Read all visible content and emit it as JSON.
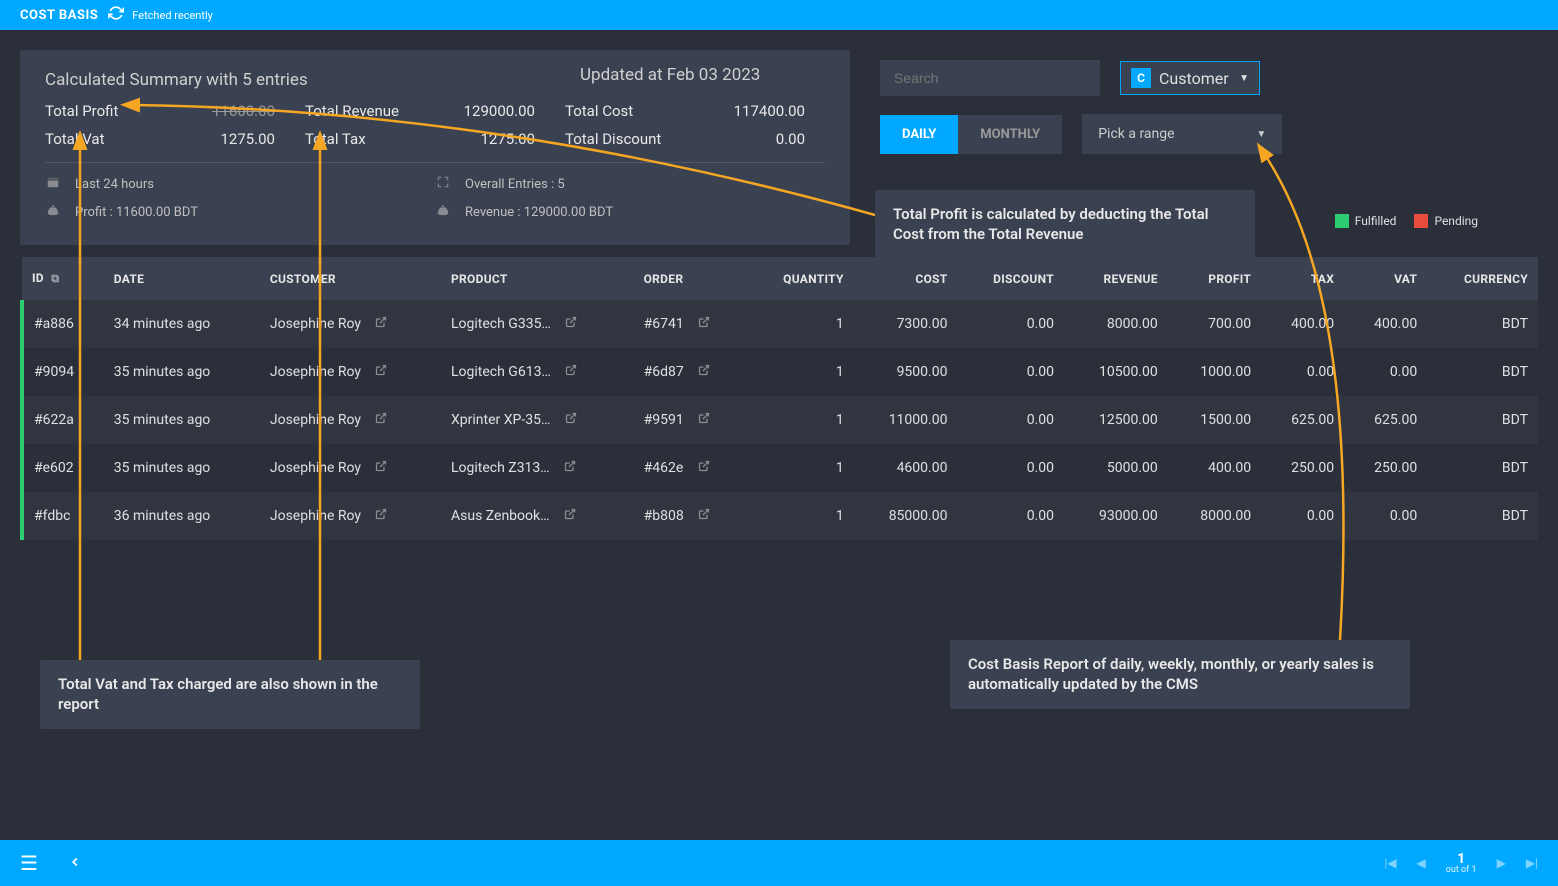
{
  "header": {
    "title": "COST BASIS",
    "fetched_label": "Fetched recently"
  },
  "summary": {
    "title": "Calculated Summary with 5 entries",
    "updated_label": "Updated at Feb 03 2023",
    "total_profit_label": "Total Profit",
    "total_profit_value": "11600.00",
    "total_revenue_label": "Total Revenue",
    "total_revenue_value": "129000.00",
    "total_cost_label": "Total Cost",
    "total_cost_value": "117400.00",
    "total_vat_label": "Total Vat",
    "total_vat_value": "1275.00",
    "total_tax_label": "Total Tax",
    "total_tax_value": "1275.00",
    "total_discount_label": "Total Discount",
    "total_discount_value": "0.00",
    "last24_label": "Last 24 hours",
    "overall_entries_label": "Overall Entries : 5",
    "profit_label": "Profit : 11600.00 BDT",
    "revenue_label": "Revenue : 129000.00 BDT"
  },
  "controls": {
    "search_placeholder": "Search",
    "filter_badge": "C",
    "filter_label": "Customer",
    "tab_daily": "DAILY",
    "tab_monthly": "MONTHLY",
    "range_label": "Pick a range",
    "legend_fulfilled": "Fulfilled",
    "legend_pending": "Pending"
  },
  "table": {
    "headers": {
      "id": "ID",
      "date": "DATE",
      "customer": "CUSTOMER",
      "product": "PRODUCT",
      "order": "ORDER",
      "quantity": "QUANTITY",
      "cost": "COST",
      "discount": "DISCOUNT",
      "revenue": "REVENUE",
      "profit": "PROFIT",
      "tax": "TAX",
      "vat": "VAT",
      "currency": "CURRENCY"
    },
    "rows": [
      {
        "id": "#a886",
        "date": "34 minutes ago",
        "customer": "Josephine Roy",
        "product": "Logitech G335…",
        "order": "#6741",
        "quantity": "1",
        "cost": "7300.00",
        "discount": "0.00",
        "revenue": "8000.00",
        "profit": "700.00",
        "tax": "400.00",
        "vat": "400.00",
        "currency": "BDT"
      },
      {
        "id": "#9094",
        "date": "35 minutes ago",
        "customer": "Josephine Roy",
        "product": "Logitech G613…",
        "order": "#6d87",
        "quantity": "1",
        "cost": "9500.00",
        "discount": "0.00",
        "revenue": "10500.00",
        "profit": "1000.00",
        "tax": "0.00",
        "vat": "0.00",
        "currency": "BDT"
      },
      {
        "id": "#622a",
        "date": "35 minutes ago",
        "customer": "Josephine Roy",
        "product": "Xprinter XP-35…",
        "order": "#9591",
        "quantity": "1",
        "cost": "11000.00",
        "discount": "0.00",
        "revenue": "12500.00",
        "profit": "1500.00",
        "tax": "625.00",
        "vat": "625.00",
        "currency": "BDT"
      },
      {
        "id": "#e602",
        "date": "35 minutes ago",
        "customer": "Josephine Roy",
        "product": "Logitech Z313…",
        "order": "#462e",
        "quantity": "1",
        "cost": "4600.00",
        "discount": "0.00",
        "revenue": "5000.00",
        "profit": "400.00",
        "tax": "250.00",
        "vat": "250.00",
        "currency": "BDT"
      },
      {
        "id": "#fdbc",
        "date": "36 minutes ago",
        "customer": "Josephine Roy",
        "product": "Asus Zenbook…",
        "order": "#b808",
        "quantity": "1",
        "cost": "85000.00",
        "discount": "0.00",
        "revenue": "93000.00",
        "profit": "8000.00",
        "tax": "0.00",
        "vat": "0.00",
        "currency": "BDT"
      }
    ]
  },
  "annotations": {
    "profit_calc": "Total Profit is calculated by deducting the Total Cost from the Total Revenue",
    "vat_tax": "Total Vat and Tax charged are also shown in the report",
    "cost_basis": "Cost Basis Report of daily, weekly, monthly, or yearly sales is automatically updated by the CMS"
  },
  "pager": {
    "page": "1",
    "out_of": "out of 1"
  }
}
